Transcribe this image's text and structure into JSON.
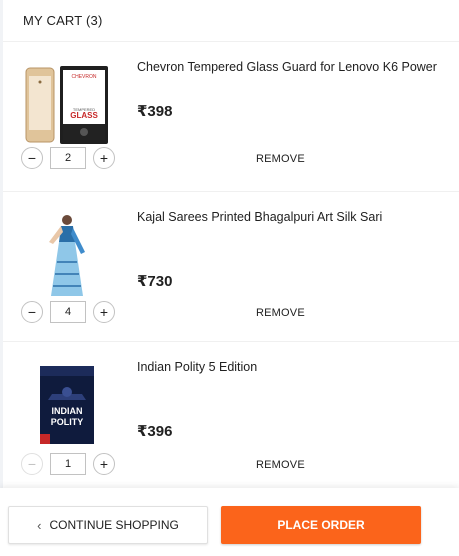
{
  "cart": {
    "header": "MY CART (3)",
    "items": [
      {
        "title": "Chevron Tempered Glass Guard for Lenovo K6 Power",
        "price": "₹398",
        "quantity": "2",
        "remove_label": "REMOVE",
        "decrement_label": "−",
        "increment_label": "+",
        "decrement_enabled": true,
        "image_icon": "phone-screen-guard-product-image",
        "image_text": {
          "brand": "CHEVRON",
          "product": "GLASS",
          "tagline": "TEMPERED"
        }
      },
      {
        "title": "Kajal Sarees Printed Bhagalpuri Art Silk Sari",
        "price": "₹730",
        "quantity": "4",
        "remove_label": "REMOVE",
        "decrement_label": "−",
        "increment_label": "+",
        "decrement_enabled": true,
        "image_icon": "saree-model-product-image"
      },
      {
        "title": "Indian Polity 5 Edition",
        "price": "₹396",
        "quantity": "1",
        "remove_label": "REMOVE",
        "decrement_label": "−",
        "increment_label": "+",
        "decrement_enabled": false,
        "image_icon": "book-cover-product-image",
        "image_text": {
          "book_title_line1": "INDIAN",
          "book_title_line2": "POLITY"
        }
      }
    ]
  },
  "footer": {
    "continue_label": "CONTINUE SHOPPING",
    "continue_chevron": "‹",
    "place_order_label": "PLACE ORDER"
  },
  "colors": {
    "accent": "#fb641b",
    "background": "#f1f3f6",
    "text": "#212121"
  }
}
